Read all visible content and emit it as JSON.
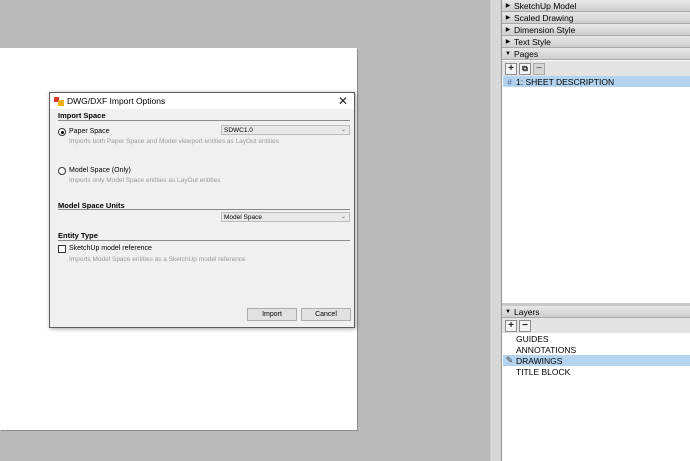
{
  "dialog": {
    "title": "DWG/DXF Import Options",
    "import_space": {
      "heading": "Import Space",
      "paper_space": {
        "label": "Paper Space",
        "selected": true,
        "hint": "Imports both Paper Space and Model viewport entities as LayOut entities",
        "select_value": "SDWC1.0"
      },
      "model_space": {
        "label": "Model Space (Only)",
        "selected": false,
        "hint": "Imports only Model Space entities as LayOut entities"
      }
    },
    "units": {
      "heading": "Model Space Units",
      "select_value": "Model Space"
    },
    "entity_type": {
      "heading": "Entity Type",
      "checkbox_label": "SketchUp model reference",
      "checked": false,
      "hint": "Imports Model Space entities as a SketchUp model reference"
    },
    "buttons": {
      "import": "Import",
      "cancel": "Cancel"
    }
  },
  "panel": {
    "sections": [
      {
        "label": "SketchUp Model",
        "expanded": false
      },
      {
        "label": "Scaled Drawing",
        "expanded": false
      },
      {
        "label": "Dimension Style",
        "expanded": false
      },
      {
        "label": "Text Style",
        "expanded": false
      },
      {
        "label": "Pages",
        "expanded": true
      }
    ],
    "pages": {
      "items": [
        {
          "number": "#",
          "label": "1: SHEET DESCRIPTION",
          "selected": true
        }
      ]
    },
    "layers": {
      "header": "Layers",
      "items": [
        {
          "label": "GUIDES",
          "active": false
        },
        {
          "label": "ANNOTATIONS",
          "active": false
        },
        {
          "label": "DRAWINGS",
          "active": true
        },
        {
          "label": "TITLE BLOCK",
          "active": false
        }
      ]
    },
    "icons": {
      "add": "+",
      "remove": "−",
      "duplicate": "⧉",
      "collapsed": "▶",
      "expanded": "▼",
      "pencil": "✎"
    }
  },
  "colors": {
    "selection": "#b3d3ee",
    "canvas": "#b9b9b9",
    "dialog_bg": "#f0f0f0"
  }
}
